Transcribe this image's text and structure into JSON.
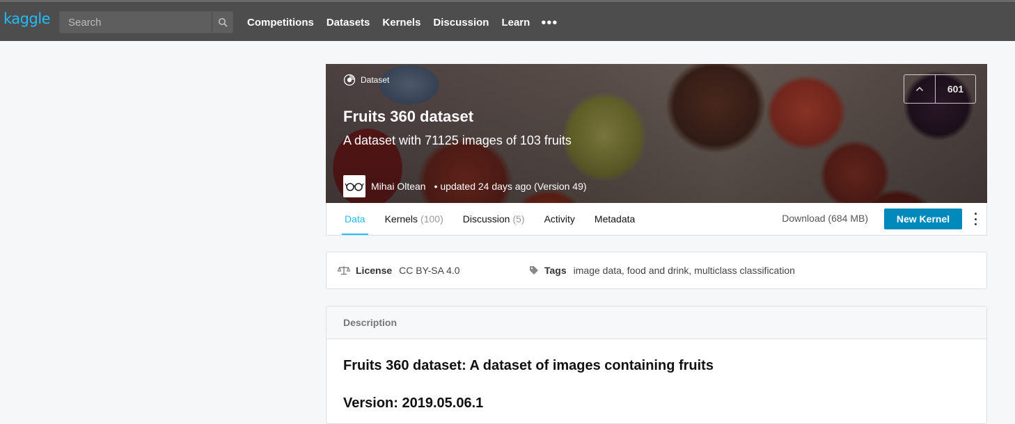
{
  "topbar": {
    "logo": "kaggle",
    "search_placeholder": "Search",
    "nav": [
      "Competitions",
      "Datasets",
      "Kernels",
      "Discussion",
      "Learn"
    ],
    "more_label": "•••"
  },
  "hero": {
    "tag": "Dataset",
    "title": "Fruits 360 dataset",
    "subtitle": "A dataset with 71125 images of 103 fruits",
    "owner": "Mihai Oltean",
    "updated": "• updated 24 days ago (Version 49)",
    "votes": "601"
  },
  "tabs": [
    {
      "label": "Data",
      "count": ""
    },
    {
      "label": "Kernels",
      "count": "(100)"
    },
    {
      "label": "Discussion",
      "count": "(5)"
    },
    {
      "label": "Activity",
      "count": ""
    },
    {
      "label": "Metadata",
      "count": ""
    }
  ],
  "actions": {
    "download": "Download (684 MB)",
    "new_kernel": "New Kernel"
  },
  "meta": {
    "license_label": "License",
    "license_value": "CC BY-SA 4.0",
    "tags_label": "Tags",
    "tags_value": "image data, food and drink, multiclass classification"
  },
  "description": {
    "header": "Description",
    "heading": "Fruits 360 dataset: A dataset of images containing fruits",
    "version": "Version: 2019.05.06.1"
  },
  "colors": {
    "accent": "#20beff",
    "button": "#008abc",
    "topbar": "#4d4d4d"
  }
}
